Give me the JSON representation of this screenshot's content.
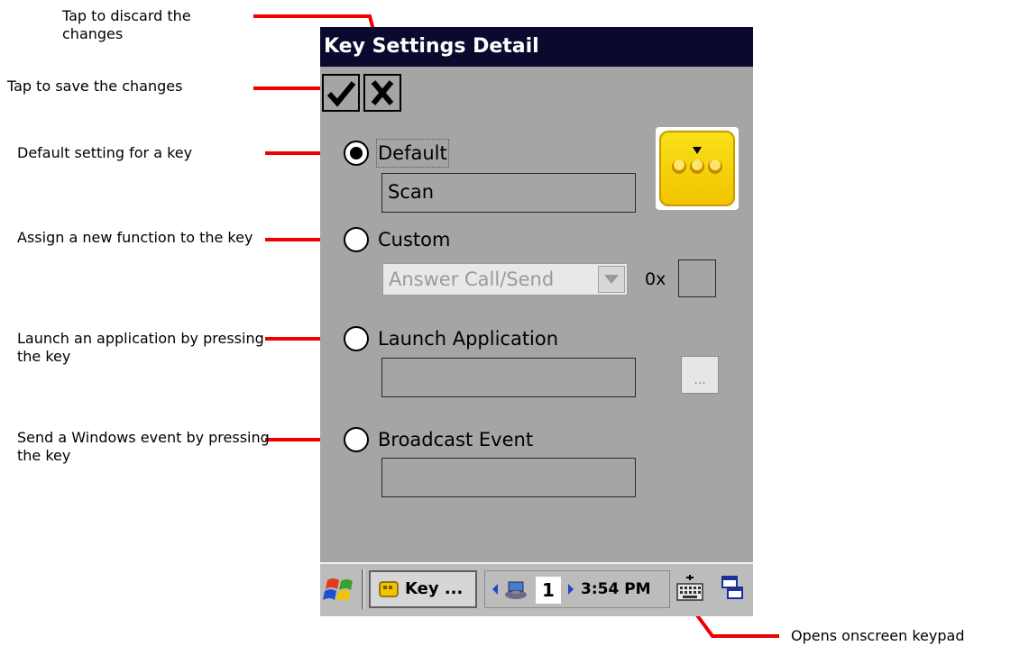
{
  "annotations": {
    "discard": "Tap to discard the changes",
    "save": "Tap to save the changes",
    "default": "Default setting for a key",
    "custom": "Assign a new function to the key",
    "launch": "Launch an application by pressing the key",
    "broadcast": "Send a Windows event by pressing the key",
    "keypad": "Opens onscreen keypad"
  },
  "window": {
    "title": "Key Settings Detail",
    "ok_icon": "checkmark-icon",
    "cancel_icon": "x-icon"
  },
  "options": {
    "default": {
      "label": "Default",
      "value": "Scan",
      "checked": true
    },
    "custom": {
      "label": "Custom",
      "selected": "Answer Call/Send",
      "hex_prefix": "0x",
      "hex_value": ""
    },
    "launch": {
      "label": "Launch Application",
      "value": "",
      "browse_label": "..."
    },
    "broadcast": {
      "label": "Broadcast Event",
      "value": ""
    }
  },
  "taskbar": {
    "task_label": "Key ...",
    "page": "1",
    "time": "3:54 PM"
  },
  "colors": {
    "annotation_line": "#ee0000",
    "titlebar": "#0a0a2e",
    "form_bg": "#a6a4a5",
    "key_icon": "#f2c400"
  }
}
